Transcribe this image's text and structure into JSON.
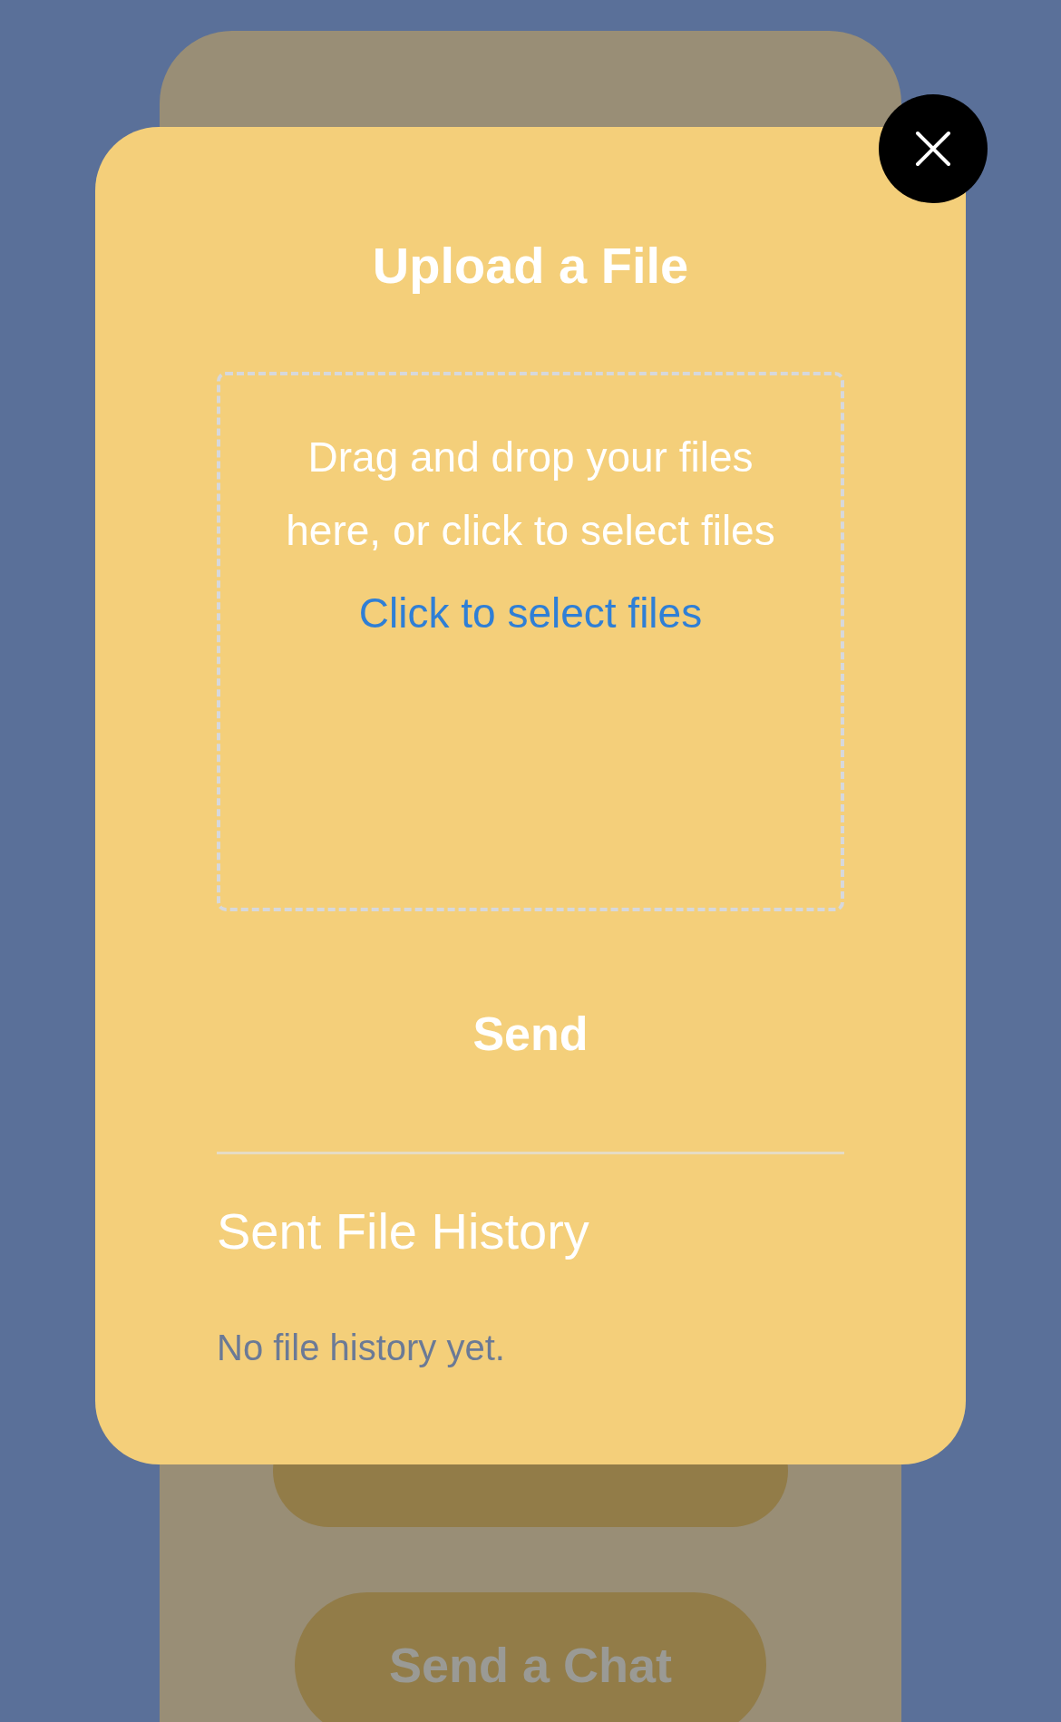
{
  "background_screen": {
    "buttons": [
      "Send a Chat"
    ]
  },
  "modal": {
    "title": "Upload a File",
    "dropzone": {
      "text": "Drag and drop your files here, or click to select files",
      "link": "Click to select files"
    },
    "send_button": "Send",
    "history": {
      "title": "Sent File History",
      "empty_text": "No file history yet."
    }
  }
}
